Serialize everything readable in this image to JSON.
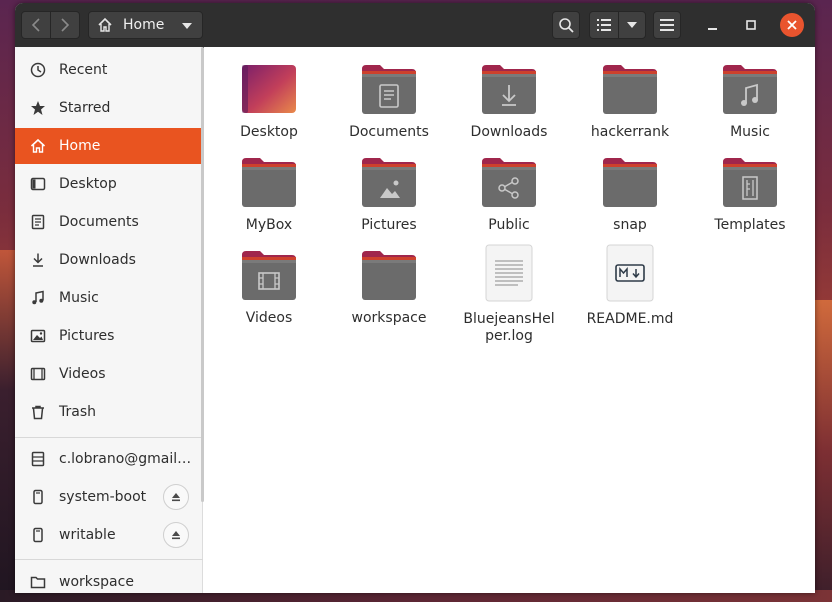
{
  "header": {
    "location": "Home"
  },
  "sidebar": {
    "places": [
      {
        "label": "Recent",
        "icon": "clock-icon"
      },
      {
        "label": "Starred",
        "icon": "star-icon"
      },
      {
        "label": "Home",
        "icon": "home-icon",
        "active": true
      },
      {
        "label": "Desktop",
        "icon": "desktop-icon"
      },
      {
        "label": "Documents",
        "icon": "document-icon"
      },
      {
        "label": "Downloads",
        "icon": "download-icon"
      },
      {
        "label": "Music",
        "icon": "music-icon"
      },
      {
        "label": "Pictures",
        "icon": "picture-icon"
      },
      {
        "label": "Videos",
        "icon": "video-icon"
      },
      {
        "label": "Trash",
        "icon": "trash-icon"
      }
    ],
    "devices": [
      {
        "label": "c.lobrano@gmail…",
        "icon": "network-drive-icon"
      },
      {
        "label": "system-boot",
        "icon": "drive-icon",
        "eject": true
      },
      {
        "label": "writable",
        "icon": "drive-icon",
        "eject": true
      }
    ],
    "bookmarks": [
      {
        "label": "workspace",
        "icon": "folder-icon"
      }
    ]
  },
  "files": [
    {
      "name": "Desktop",
      "type": "desktop-folder"
    },
    {
      "name": "Documents",
      "type": "folder",
      "emblem": "document"
    },
    {
      "name": "Downloads",
      "type": "folder",
      "emblem": "download"
    },
    {
      "name": "hackerrank",
      "type": "folder"
    },
    {
      "name": "Music",
      "type": "folder",
      "emblem": "music"
    },
    {
      "name": "MyBox",
      "type": "folder"
    },
    {
      "name": "Pictures",
      "type": "folder",
      "emblem": "picture"
    },
    {
      "name": "Public",
      "type": "folder",
      "emblem": "share"
    },
    {
      "name": "snap",
      "type": "folder"
    },
    {
      "name": "Templates",
      "type": "folder",
      "emblem": "template"
    },
    {
      "name": "Videos",
      "type": "folder",
      "emblem": "video"
    },
    {
      "name": "workspace",
      "type": "folder"
    },
    {
      "name": "BluejeansHelper.log",
      "display": "BluejeansHel\nper.log",
      "type": "text-file"
    },
    {
      "name": "README.md",
      "type": "markdown-file"
    }
  ],
  "colors": {
    "accent": "#e95420",
    "folder_body": "#6b6b6b",
    "folder_tab": "#a0264c",
    "headerbar": "#2f2f2f"
  }
}
